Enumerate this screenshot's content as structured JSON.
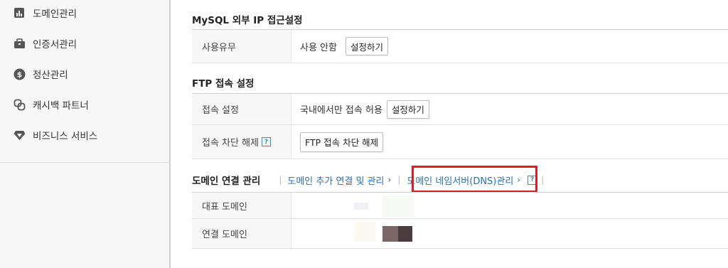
{
  "sidebar": {
    "items": [
      {
        "label": "도메인관리",
        "icon": "bar-chart-icon"
      },
      {
        "label": "인증서관리",
        "icon": "briefcase-icon"
      },
      {
        "label": "정산관리",
        "icon": "dollar-icon"
      },
      {
        "label": "캐시백 파트너",
        "icon": "link-icon"
      },
      {
        "label": "비즈니스 서비스",
        "icon": "diamond-icon"
      }
    ]
  },
  "mysql": {
    "title": "MySQL 외부 IP 접근설정",
    "use_label": "사용유무",
    "use_value": "사용 안함",
    "set_button": "설정하기"
  },
  "ftp": {
    "title": "FTP 접속 설정",
    "conn_label": "접속 설정",
    "conn_value": "국내에서만 접속 허용",
    "set_button": "설정하기",
    "unblock_label": "접속 차단 해제",
    "unblock_button": "FTP 접속 차단 해제",
    "help": "?"
  },
  "domain": {
    "title": "도메인 연결 관리",
    "link_add": "도메인 추가 연결 및 관리",
    "link_dns": "도메인 네임서버(DNS)관리",
    "chevron": "›",
    "help": "?",
    "rep_label": "대표 도메인",
    "conn_label": "연결 도메인"
  }
}
